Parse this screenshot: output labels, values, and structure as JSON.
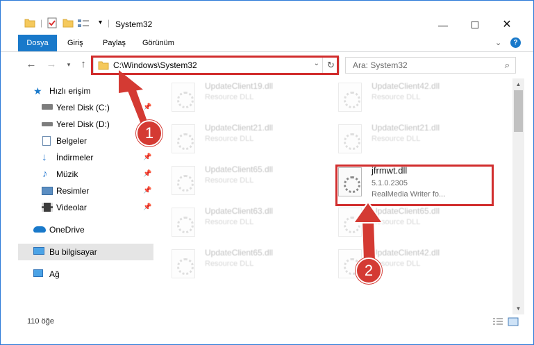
{
  "window": {
    "title": "System32",
    "controls": [
      "minimize-icon",
      "maximize-icon",
      "close-icon"
    ]
  },
  "ribbon": {
    "tabs": [
      "Dosya",
      "Giriş",
      "Paylaş",
      "Görünüm"
    ]
  },
  "nav": {
    "address": "C:\\Windows\\System32",
    "search_placeholder": "Ara: System32"
  },
  "sidebar": {
    "items": [
      {
        "label": "Hızlı erişim",
        "icon": "star-icon",
        "pinned": false
      },
      {
        "label": "Yerel Disk (C:)",
        "icon": "drive-icon",
        "pinned": true
      },
      {
        "label": "Yerel Disk (D:)",
        "icon": "drive-icon",
        "pinned": true
      },
      {
        "label": "Belgeler",
        "icon": "documents-icon",
        "pinned": true
      },
      {
        "label": "İndirmeler",
        "icon": "download-icon",
        "pinned": true
      },
      {
        "label": "Müzik",
        "icon": "music-icon",
        "pinned": true
      },
      {
        "label": "Resimler",
        "icon": "pictures-icon",
        "pinned": true
      },
      {
        "label": "Videolar",
        "icon": "videos-icon",
        "pinned": true
      },
      {
        "label": "OneDrive",
        "icon": "cloud-icon",
        "pinned": false
      },
      {
        "label": "Bu bilgisayar",
        "icon": "computer-icon",
        "pinned": false,
        "selected": true
      },
      {
        "label": "Ağ",
        "icon": "network-icon",
        "pinned": false
      }
    ]
  },
  "files": {
    "left": [
      {
        "name": "UpdateClient19.dll",
        "type": "Resource DLL"
      },
      {
        "name": "UpdateClient21.dll",
        "type": "Resource DLL"
      },
      {
        "name": "UpdateClient65.dll",
        "type": "Resource DLL"
      },
      {
        "name": "UpdateClient63.dll",
        "type": "Resource DLL"
      },
      {
        "name": "UpdateClient65.dll",
        "type": "Resource DLL"
      }
    ],
    "right": [
      {
        "name": "UpdateClient42.dll",
        "type": "Resource DLL"
      },
      {
        "name": "UpdateClient21.dll",
        "type": "Resource DLL"
      },
      {
        "name": "jfrmwt.dll",
        "version": "5.1.0.2305",
        "description": "RealMedia Writer fo..."
      },
      {
        "name": "UpdateClient65.dll",
        "type": "Resource DLL"
      },
      {
        "name": "UpdateClient42.dll",
        "type": "Resource DLL"
      }
    ]
  },
  "status": {
    "count": "110 öğe"
  },
  "callouts": [
    "1",
    "2"
  ],
  "colors": {
    "accent": "#1979ca",
    "highlight": "#d12d2d",
    "callout": "#d43a33"
  }
}
